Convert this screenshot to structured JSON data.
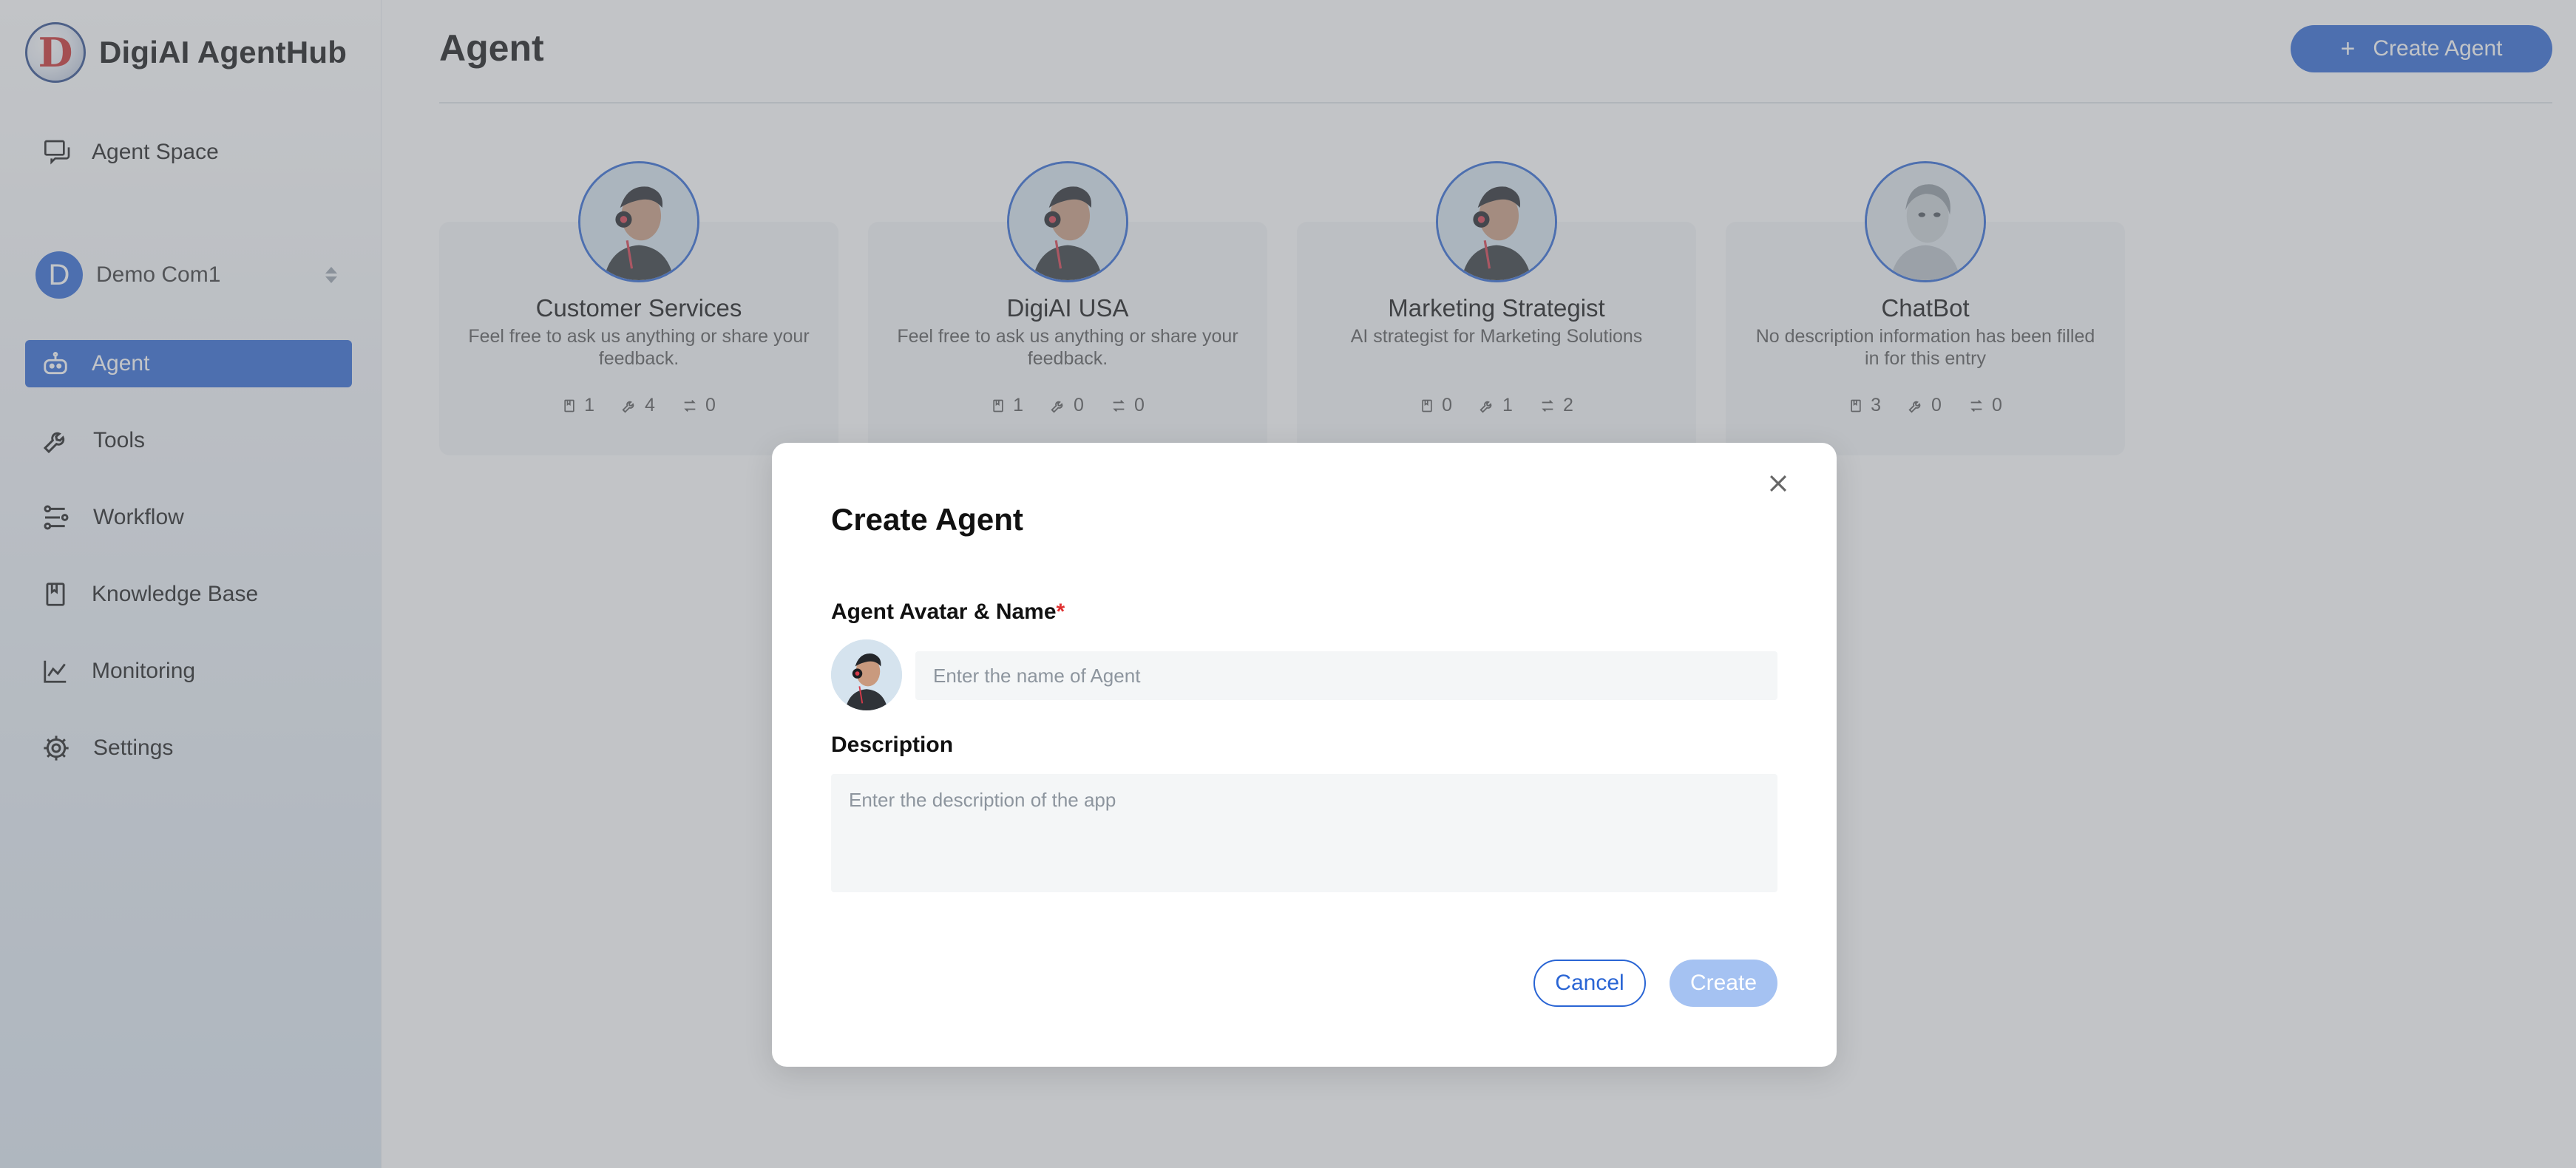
{
  "app": {
    "name": "DigiAI AgentHub",
    "logo_letter": "D"
  },
  "sidebar": {
    "agent_space_label": "Agent Space",
    "workspace": {
      "initial": "D",
      "name": "Demo Com1"
    },
    "items": [
      {
        "label": "Agent",
        "icon": "robot-icon",
        "active": true
      },
      {
        "label": "Tools",
        "icon": "wrench-icon",
        "active": false
      },
      {
        "label": "Workflow",
        "icon": "workflow-icon",
        "active": false
      },
      {
        "label": "Knowledge Base",
        "icon": "book-icon",
        "active": false
      },
      {
        "label": "Monitoring",
        "icon": "chart-icon",
        "active": false
      },
      {
        "label": "Settings",
        "icon": "gear-icon",
        "active": false
      }
    ]
  },
  "header": {
    "title": "Agent",
    "create_button_label": "Create Agent"
  },
  "agents": [
    {
      "name": "Customer Services",
      "description": "Feel free to ask us anything or share your feedback.",
      "knowledge": "1",
      "tools": "4",
      "workflows": "0"
    },
    {
      "name": "DigiAI USA",
      "description": "Feel free to ask us anything or share your feedback.",
      "knowledge": "1",
      "tools": "0",
      "workflows": "0"
    },
    {
      "name": "Marketing Strategist",
      "description": "AI strategist for Marketing Solutions",
      "knowledge": "0",
      "tools": "1",
      "workflows": "2"
    },
    {
      "name": "ChatBot",
      "description": "No description information has been filled in for this entry",
      "knowledge": "3",
      "tools": "0",
      "workflows": "0"
    }
  ],
  "modal": {
    "title": "Create Agent",
    "avatar_name_label": "Agent Avatar & Name",
    "required_mark": "*",
    "name_placeholder": "Enter the name of Agent",
    "name_value": "",
    "description_label": "Description",
    "description_placeholder": "Enter the description of the app",
    "description_value": "",
    "cancel_label": "Cancel",
    "create_label": "Create"
  },
  "colors": {
    "accent": "#2a65d4",
    "create_disabled": "#a5c2f2",
    "required": "#e03131"
  }
}
